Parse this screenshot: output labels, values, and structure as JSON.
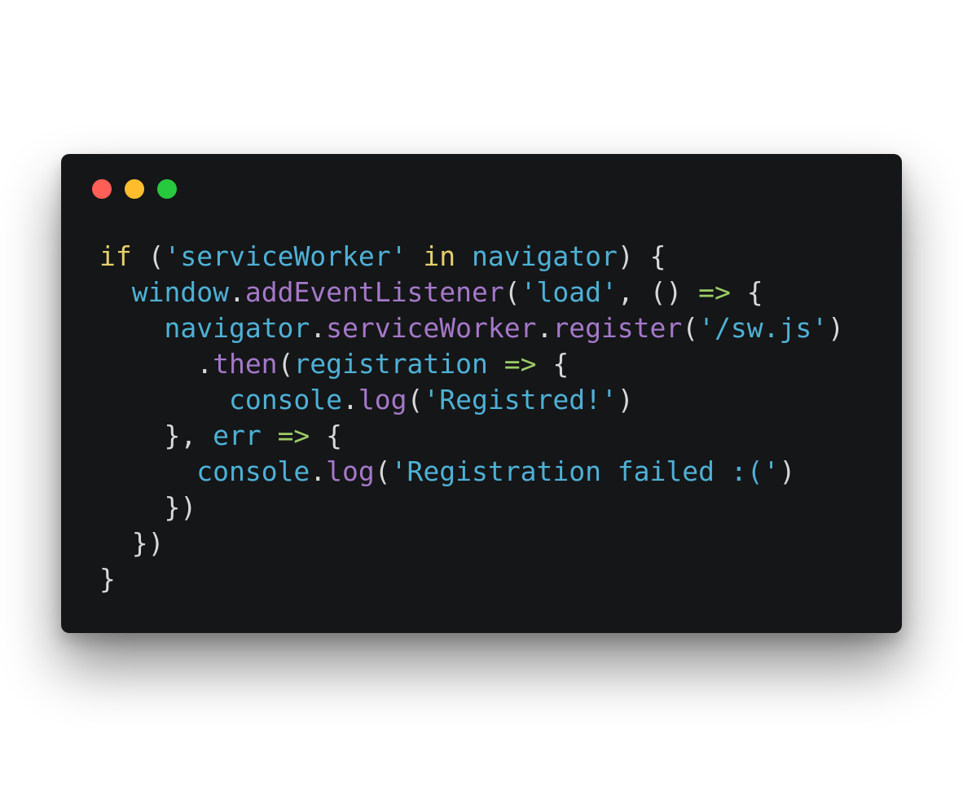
{
  "window": {
    "buttons": [
      {
        "name": "close",
        "color": "#ff5f56"
      },
      {
        "name": "minimize",
        "color": "#ffbd2e"
      },
      {
        "name": "zoom",
        "color": "#27c93f"
      }
    ]
  },
  "theme": {
    "background": "#151618",
    "keyword": "#e5cf6a",
    "plain": "#d8d8d8",
    "string": "#4eb1d6",
    "identifier": "#4eb1d6",
    "method": "#a578c9",
    "arrow": "#9ccc65"
  },
  "code": {
    "lines": [
      [
        {
          "t": "if",
          "k": "keyword"
        },
        {
          "t": " (",
          "k": "plain"
        },
        {
          "t": "'serviceWorker'",
          "k": "string"
        },
        {
          "t": " ",
          "k": "plain"
        },
        {
          "t": "in",
          "k": "keyword"
        },
        {
          "t": " ",
          "k": "plain"
        },
        {
          "t": "navigator",
          "k": "ident"
        },
        {
          "t": ") {",
          "k": "plain"
        }
      ],
      [
        {
          "t": "  ",
          "k": "plain"
        },
        {
          "t": "window",
          "k": "ident"
        },
        {
          "t": ".",
          "k": "plain"
        },
        {
          "t": "addEventListener",
          "k": "method"
        },
        {
          "t": "(",
          "k": "plain"
        },
        {
          "t": "'load'",
          "k": "string"
        },
        {
          "t": ", () ",
          "k": "plain"
        },
        {
          "t": "=>",
          "k": "arrow"
        },
        {
          "t": " {",
          "k": "plain"
        }
      ],
      [
        {
          "t": "    ",
          "k": "plain"
        },
        {
          "t": "navigator",
          "k": "ident"
        },
        {
          "t": ".",
          "k": "plain"
        },
        {
          "t": "serviceWorker",
          "k": "method"
        },
        {
          "t": ".",
          "k": "plain"
        },
        {
          "t": "register",
          "k": "method"
        },
        {
          "t": "(",
          "k": "plain"
        },
        {
          "t": "'/sw.js'",
          "k": "string"
        },
        {
          "t": ")",
          "k": "plain"
        }
      ],
      [
        {
          "t": "      .",
          "k": "plain"
        },
        {
          "t": "then",
          "k": "method"
        },
        {
          "t": "(",
          "k": "plain"
        },
        {
          "t": "registration",
          "k": "ident"
        },
        {
          "t": " ",
          "k": "plain"
        },
        {
          "t": "=>",
          "k": "arrow"
        },
        {
          "t": " {",
          "k": "plain"
        }
      ],
      [
        {
          "t": "        ",
          "k": "plain"
        },
        {
          "t": "console",
          "k": "ident"
        },
        {
          "t": ".",
          "k": "plain"
        },
        {
          "t": "log",
          "k": "method"
        },
        {
          "t": "(",
          "k": "plain"
        },
        {
          "t": "'Registred!'",
          "k": "string"
        },
        {
          "t": ")",
          "k": "plain"
        }
      ],
      [
        {
          "t": "    }, ",
          "k": "plain"
        },
        {
          "t": "err",
          "k": "ident"
        },
        {
          "t": " ",
          "k": "plain"
        },
        {
          "t": "=>",
          "k": "arrow"
        },
        {
          "t": " {",
          "k": "plain"
        }
      ],
      [
        {
          "t": "      ",
          "k": "plain"
        },
        {
          "t": "console",
          "k": "ident"
        },
        {
          "t": ".",
          "k": "plain"
        },
        {
          "t": "log",
          "k": "method"
        },
        {
          "t": "(",
          "k": "plain"
        },
        {
          "t": "'Registration failed :('",
          "k": "string"
        },
        {
          "t": ")",
          "k": "plain"
        }
      ],
      [
        {
          "t": "    })",
          "k": "plain"
        }
      ],
      [
        {
          "t": "  })",
          "k": "plain"
        }
      ],
      [
        {
          "t": "}",
          "k": "plain"
        }
      ]
    ]
  }
}
